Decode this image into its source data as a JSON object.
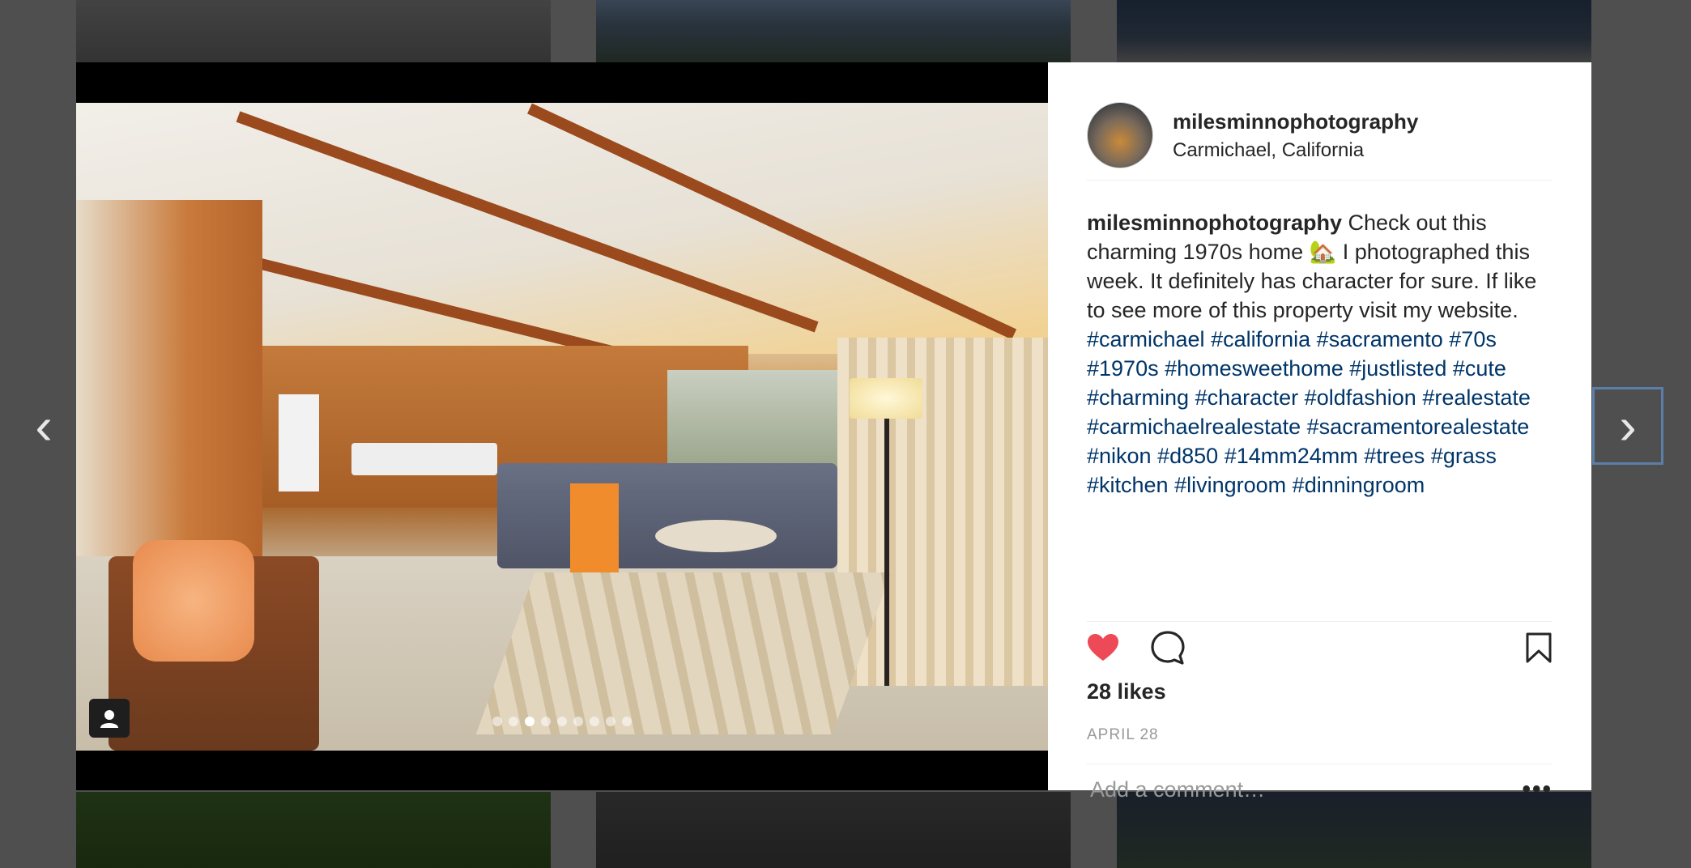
{
  "post": {
    "username": "milesminnophotography",
    "location": "Carmichael, California",
    "caption_user": "milesminnophotography",
    "caption_text": " Check out this charming 1970s home 🏡 I photographed this week. It definitely has character for sure. If like to see more of this property visit my website. ",
    "hashtags": [
      "#carmichael",
      "#california",
      "#sacramento",
      "#70s",
      "#1970s",
      "#homesweethome",
      "#justlisted",
      "#cute",
      "#charming",
      "#character",
      "#oldfashion",
      "#realestate",
      "#carmichaelrealestate",
      "#sacramentorealestate",
      "#nikon",
      "#d850",
      "#14mm24mm",
      "#trees",
      "#grass",
      "#kitchen",
      "#livingroom",
      "#dinningroom"
    ],
    "likes": "28 likes",
    "date": "APRIL 28",
    "liked": true,
    "comment_placeholder": "Add a comment…",
    "more_label": "•••"
  },
  "carousel": {
    "total": 9,
    "active_index": 2
  },
  "nav": {
    "prev_icon": "chevron-left-icon",
    "next_icon": "chevron-right-icon",
    "prev_glyph": "‹",
    "next_glyph": "›"
  },
  "colors": {
    "heart": "#ed4956",
    "hashtag": "#003569",
    "text": "#262626",
    "muted": "#999999"
  }
}
